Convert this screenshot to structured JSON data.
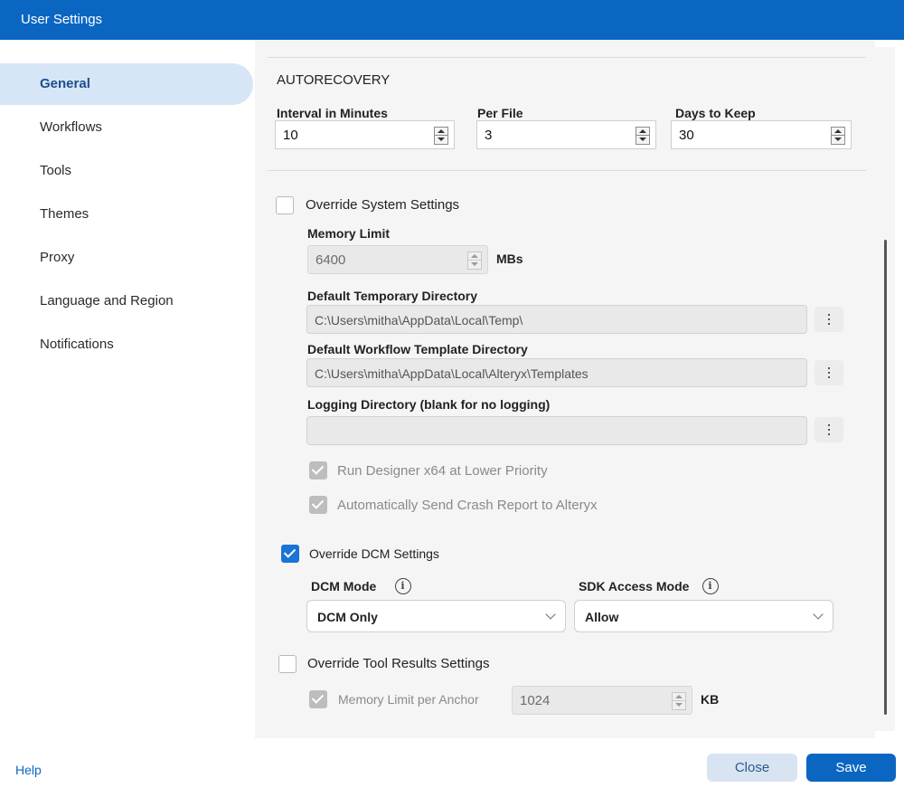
{
  "window": {
    "title": "User Settings"
  },
  "sidebar": {
    "items": [
      {
        "label": "General",
        "active": true
      },
      {
        "label": "Workflows"
      },
      {
        "label": "Tools"
      },
      {
        "label": "Themes"
      },
      {
        "label": "Proxy"
      },
      {
        "label": "Language and Region"
      },
      {
        "label": "Notifications"
      }
    ]
  },
  "autorecovery": {
    "title": "AUTORECOVERY",
    "interval": {
      "label": "Interval in Minutes",
      "value": "10"
    },
    "per_file": {
      "label": "Per File",
      "value": "3"
    },
    "days": {
      "label": "Days to Keep",
      "value": "30"
    }
  },
  "system": {
    "override_label": "Override System Settings",
    "override_checked": false,
    "memory_limit_label": "Memory Limit",
    "memory_limit_value": "6400",
    "memory_unit": "MBs",
    "temp_dir_label": "Default Temporary Directory",
    "temp_dir_value": "C:\\Users\\mitha\\AppData\\Local\\Temp\\",
    "template_dir_label": "Default Workflow Template Directory",
    "template_dir_value": "C:\\Users\\mitha\\AppData\\Local\\Alteryx\\Templates",
    "logging_dir_label": "Logging Directory (blank for no logging)",
    "logging_dir_value": "",
    "low_priority_label": "Run Designer x64 at Lower Priority",
    "crash_report_label": "Automatically Send Crash Report to Alteryx"
  },
  "dcm": {
    "override_label": "Override DCM Settings",
    "override_checked": true,
    "mode_label": "DCM Mode",
    "mode_value": "DCM Only",
    "sdk_label": "SDK Access Mode",
    "sdk_value": "Allow"
  },
  "tool_results": {
    "override_label": "Override Tool Results Settings",
    "override_checked": false,
    "memory_label": "Memory Limit per Anchor",
    "memory_value": "1024",
    "memory_unit": "KB"
  },
  "footer": {
    "help_label": "Help",
    "close_label": "Close",
    "save_label": "Save"
  },
  "colors": {
    "accent": "#0b66c2",
    "sidebar_active_bg": "#d6e6f7",
    "content_bg": "#f5f5f5",
    "checkbox_checked": "#1a73d6"
  }
}
